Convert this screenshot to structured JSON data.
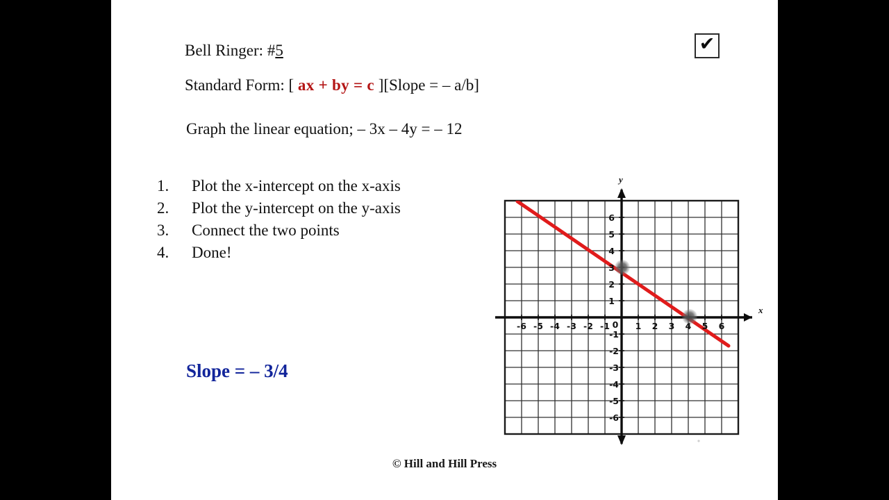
{
  "slide": {
    "background_color": "#ffffff",
    "letterbox_color": "#000000",
    "heading": {
      "bell_ringer_prefix": "Bell Ringer: #",
      "bell_ringer_number": "5",
      "standard_form_prefix": "Standard Form",
      "standard_form_colon": ": [ ",
      "standard_form_formula": "ax + by = c",
      "standard_form_suffix": " ][Slope = – a/b]",
      "graph_instruction": "Graph the linear equation; – 3x – 4y = – 12"
    },
    "check_mark": {
      "icon": "check-icon",
      "glyph": "✔"
    },
    "steps": [
      {
        "number": "1.",
        "text": "Plot the x-intercept on the x-axis"
      },
      {
        "number": "2.",
        "text": "Plot the y-intercept on the y-axis"
      },
      {
        "number": "3.",
        "text": "Connect the two points"
      },
      {
        "number": "4.",
        "text": "Done!"
      }
    ],
    "slope_answer": "Slope = – 3/4",
    "footer": "© Hill and Hill Press"
  },
  "chart_data": {
    "type": "line",
    "title": "",
    "xlabel": "x",
    "ylabel": "y",
    "equation": "-3x - 4y = -12",
    "slope": -0.75,
    "y_intercept": 3,
    "x_intercept": 4,
    "xlim": [
      -7,
      7
    ],
    "ylim": [
      -7,
      7
    ],
    "grid": true,
    "grid_step": 1,
    "legend": "none",
    "line_color": "#e01b1b",
    "point_color": "#5a5a5a",
    "x_tick_labels": [
      "-6",
      "-5",
      "-4",
      "-3",
      "-2",
      "-1",
      "0",
      "1",
      "2",
      "3",
      "4",
      "5",
      "6"
    ],
    "y_tick_labels": [
      "6",
      "5",
      "4",
      "3",
      "2",
      "1",
      "-1",
      "-2",
      "-3",
      "-4",
      "-5",
      "-6"
    ],
    "x_ticks": [
      -6,
      -5,
      -4,
      -3,
      -2,
      -1,
      0,
      1,
      2,
      3,
      4,
      5,
      6
    ],
    "y_ticks": [
      6,
      5,
      4,
      3,
      2,
      1,
      -1,
      -2,
      -3,
      -4,
      -5,
      -6
    ],
    "series": [
      {
        "name": "-3x - 4y = -12",
        "x": [
          -6.7,
          7.0
        ],
        "y": [
          8.025,
          -2.25
        ]
      }
    ],
    "points": [
      {
        "label": "y-intercept",
        "x": 0,
        "y": 3
      },
      {
        "label": "x-intercept",
        "x": 4,
        "y": 0
      }
    ]
  }
}
